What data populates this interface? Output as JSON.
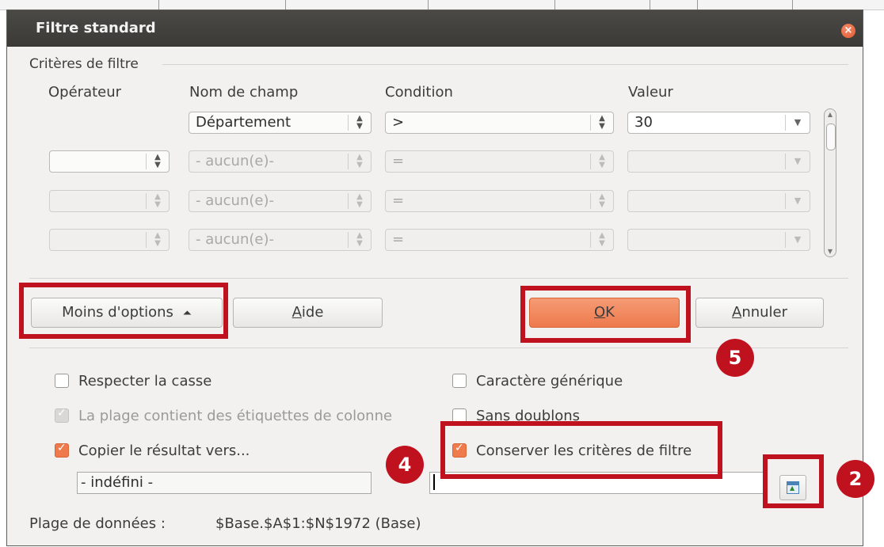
{
  "dialog": {
    "title": "Filtre standard",
    "close_glyph": "×"
  },
  "criteria": {
    "section_label": "Critères de filtre",
    "headers": {
      "operator": "Opérateur",
      "field_name": "Nom de champ",
      "condition": "Condition",
      "value": "Valeur"
    },
    "rows": [
      {
        "operator": "",
        "field": "Département",
        "condition": ">",
        "value": "30",
        "enabled": true,
        "has_operator": false
      },
      {
        "operator": "",
        "field": "- aucun(e)-",
        "condition": "=",
        "value": "",
        "enabled": false,
        "has_operator": true
      },
      {
        "operator": "",
        "field": "- aucun(e)-",
        "condition": "=",
        "value": "",
        "enabled": false,
        "has_operator": true
      },
      {
        "operator": "",
        "field": "- aucun(e)-",
        "condition": "=",
        "value": "",
        "enabled": false,
        "has_operator": true
      }
    ]
  },
  "buttons": {
    "fewer_options": "Moins d'options",
    "fewer_options_glyph": "⏶",
    "help_pre": "",
    "help_u": "A",
    "help_post": "ide",
    "ok_u": "O",
    "ok_post": "K",
    "cancel_u": "A",
    "cancel_post": "nnuler"
  },
  "options": {
    "case_sensitive": {
      "label": "Respecter la casse",
      "checked": false
    },
    "range_has_labels": {
      "label": "La plage contient des étiquettes de colonne",
      "checked": true,
      "disabled": true
    },
    "copy_results": {
      "label": "Copier le résultat vers...",
      "checked": true
    },
    "wildcards": {
      "label": "Caractère générique",
      "checked": false
    },
    "no_duplicates": {
      "label": "Sans doublons",
      "checked": false
    },
    "keep_criteria": {
      "label": "Conserver les critères de filtre",
      "checked": true
    }
  },
  "copy_target": {
    "named_range": "- indéfini -",
    "cell_ref": ""
  },
  "data_range": {
    "label": "Plage de données :",
    "value": "$Base.$A$1:$N$1972 (Base)"
  },
  "callouts": [
    "5",
    "4",
    "2"
  ],
  "colors": {
    "accent": "#ef7b4d",
    "callout": "#c0111f",
    "titlebar": "#3b3a36"
  },
  "icons": [
    "close-icon",
    "spin-arrows-icon",
    "dropdown-arrow-icon",
    "collapse-up-icon",
    "checkbox-icon",
    "shrink-dialog-icon"
  ]
}
